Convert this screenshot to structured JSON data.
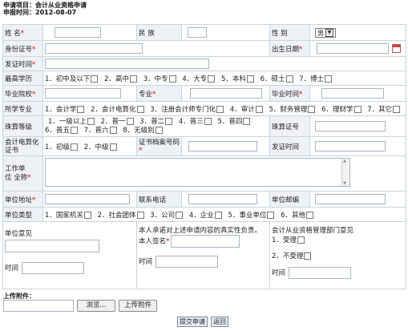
{
  "header": {
    "project_line": "申请项目：会计从业资格申请",
    "time_line": "申报时间：2012-08-07"
  },
  "labels": {
    "name": "姓  名",
    "ethnicity": "民    族",
    "gender": "性 别",
    "gender_value": "男",
    "id_number": "身份证号",
    "birth_date": "出生日期",
    "issue_authority": "发证时间",
    "education": "最高学历",
    "school": "毕业院校",
    "major": "专业",
    "grad_time": "毕业时间",
    "studied_major": "所学专业",
    "abacus_level": "珠算等级",
    "abacus_cert_no": "珠算证号",
    "comp_cert_line1": "会计电算化",
    "comp_cert_line2": "证书",
    "cert_file_no": "证书档案号码",
    "issue_time": "发证时间",
    "work_unit_line1": "工作单",
    "work_unit_line2": "位 全称",
    "unit_address": "单位地址",
    "contact_phone": "联系电话",
    "postcode": "单位邮编",
    "unit_type": "单位类型",
    "unit_opinion": "单位意见",
    "time": "时间",
    "pledge": "本人承诺对上述申请内容的真实性负责。",
    "signature": "本人签名",
    "mgmt_opinion": "会计从业资格管理部门意见",
    "accept": "1．受理",
    "reject": "2．不受理",
    "required_mark": "*"
  },
  "options": {
    "education": [
      "1．初中及以下",
      "2．高中",
      "3．中专",
      "4．大专",
      "5．本科",
      "6．硕士",
      "7．博士"
    ],
    "studied_major": [
      "1．会计学",
      "2．会计电算化",
      "3．注册会计师专门化",
      "4．审计",
      "5．财务管理",
      "6．理财学",
      "7．其它"
    ],
    "abacus_row1": [
      "1．一级以上",
      "2．普一",
      "3．普二",
      "4．普三",
      "5．普四"
    ],
    "abacus_row2": [
      "6．普五",
      "7．普六",
      "8．无级别"
    ],
    "comp_cert": [
      "1．初级",
      "2．中级"
    ],
    "unit_type": [
      "1．国家机关",
      "2．社会团体",
      "3．公司",
      "4．企业",
      "5．事业单位",
      "6．其他"
    ]
  },
  "upload": {
    "label": "上传附件：",
    "browse": "浏览...",
    "upload_btn": "上传附件"
  },
  "actions": {
    "submit": "提交申请",
    "back": "返回"
  }
}
